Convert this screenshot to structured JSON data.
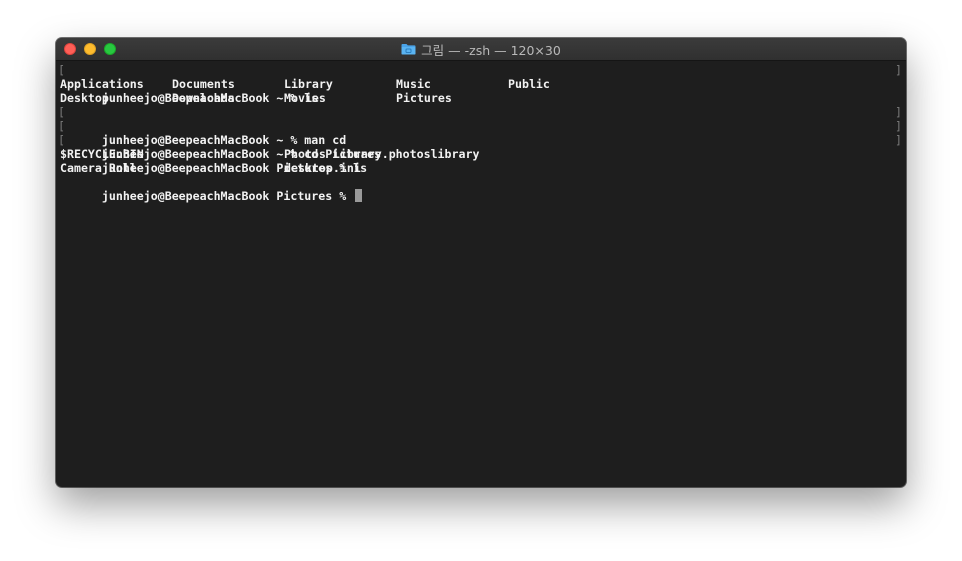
{
  "window": {
    "title": "그림 — -zsh — 120×30",
    "folder_icon": "folder-icon",
    "colors": {
      "background": "#1e1e1e",
      "text": "#f2f2f2",
      "cursor": "#9a9a9a"
    }
  },
  "terminal": {
    "bracket_left": "[",
    "bracket_right": "]",
    "prompt1": "junheejo@BeepeachMacBook ~ % ls",
    "ls1_row1": [
      "Applications",
      "Documents",
      "Library",
      "Music",
      "Public"
    ],
    "ls1_row2": [
      "Desktop",
      "Downloads",
      "Movies",
      "Pictures"
    ],
    "prompt2": "junheejo@BeepeachMacBook ~ % man cd",
    "prompt3": "junheejo@BeepeachMacBook ~ % cd Pictures",
    "prompt4": "junheejo@BeepeachMacBook Pictures % ls",
    "ls2_row1": [
      "$RECYCLE.BIN",
      "Photos Library.photoslibrary"
    ],
    "ls2_row2": [
      "Camera Roll",
      "desktop.ini"
    ],
    "current_prompt": "junheejo@BeepeachMacBook Pictures % "
  }
}
